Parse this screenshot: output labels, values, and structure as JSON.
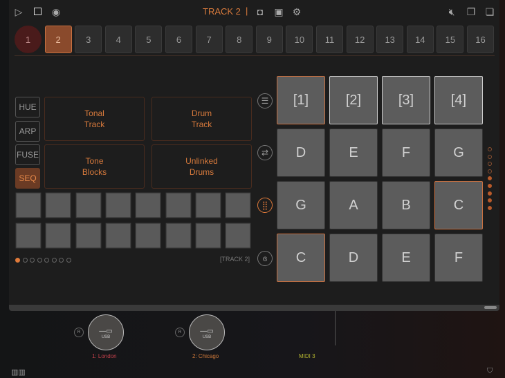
{
  "topbar": {
    "title": "TRACK 2",
    "separator": "|",
    "icons": [
      "play-icon",
      "stop-icon",
      "record-icon",
      "camera-icon",
      "image-icon",
      "gear-icon",
      "mute-icon",
      "copy-icon",
      "paste-icon"
    ]
  },
  "tracks": [
    "1",
    "2",
    "3",
    "4",
    "5",
    "6",
    "7",
    "8",
    "9",
    "10",
    "11",
    "12",
    "13",
    "14",
    "15",
    "16"
  ],
  "selected_track": "2",
  "modes": [
    "HUE",
    "ARP",
    "FUSE",
    "SEQ"
  ],
  "selected_mode": "SEQ",
  "track_types": [
    "Tonal\nTrack",
    "Drum\nTrack",
    "Tone\nBlocks",
    "Unlinked\nDrums"
  ],
  "page_label": "[TRACK 2]",
  "page_dots": {
    "count": 8,
    "active": 1
  },
  "grid": {
    "banks": [
      "[1]",
      "[2]",
      "[3]",
      "[4]"
    ],
    "rows": [
      [
        "D",
        "E",
        "F",
        "G"
      ],
      [
        "G",
        "A",
        "B",
        "C"
      ],
      [
        "C",
        "D",
        "E",
        "F"
      ]
    ]
  },
  "octave_dots": {
    "total": 9,
    "filled": 5
  },
  "devices": [
    {
      "name": "1: London",
      "port": "USB",
      "r": "R",
      "color": "#c0404a"
    },
    {
      "name": "2: Chicago",
      "port": "USB",
      "r": "R",
      "color": "#d07a3a"
    },
    {
      "name": "MIDI 3",
      "color": "#b8b830"
    }
  ],
  "colors": {
    "accent": "#d87a3c",
    "background": "#1d1d1d"
  }
}
